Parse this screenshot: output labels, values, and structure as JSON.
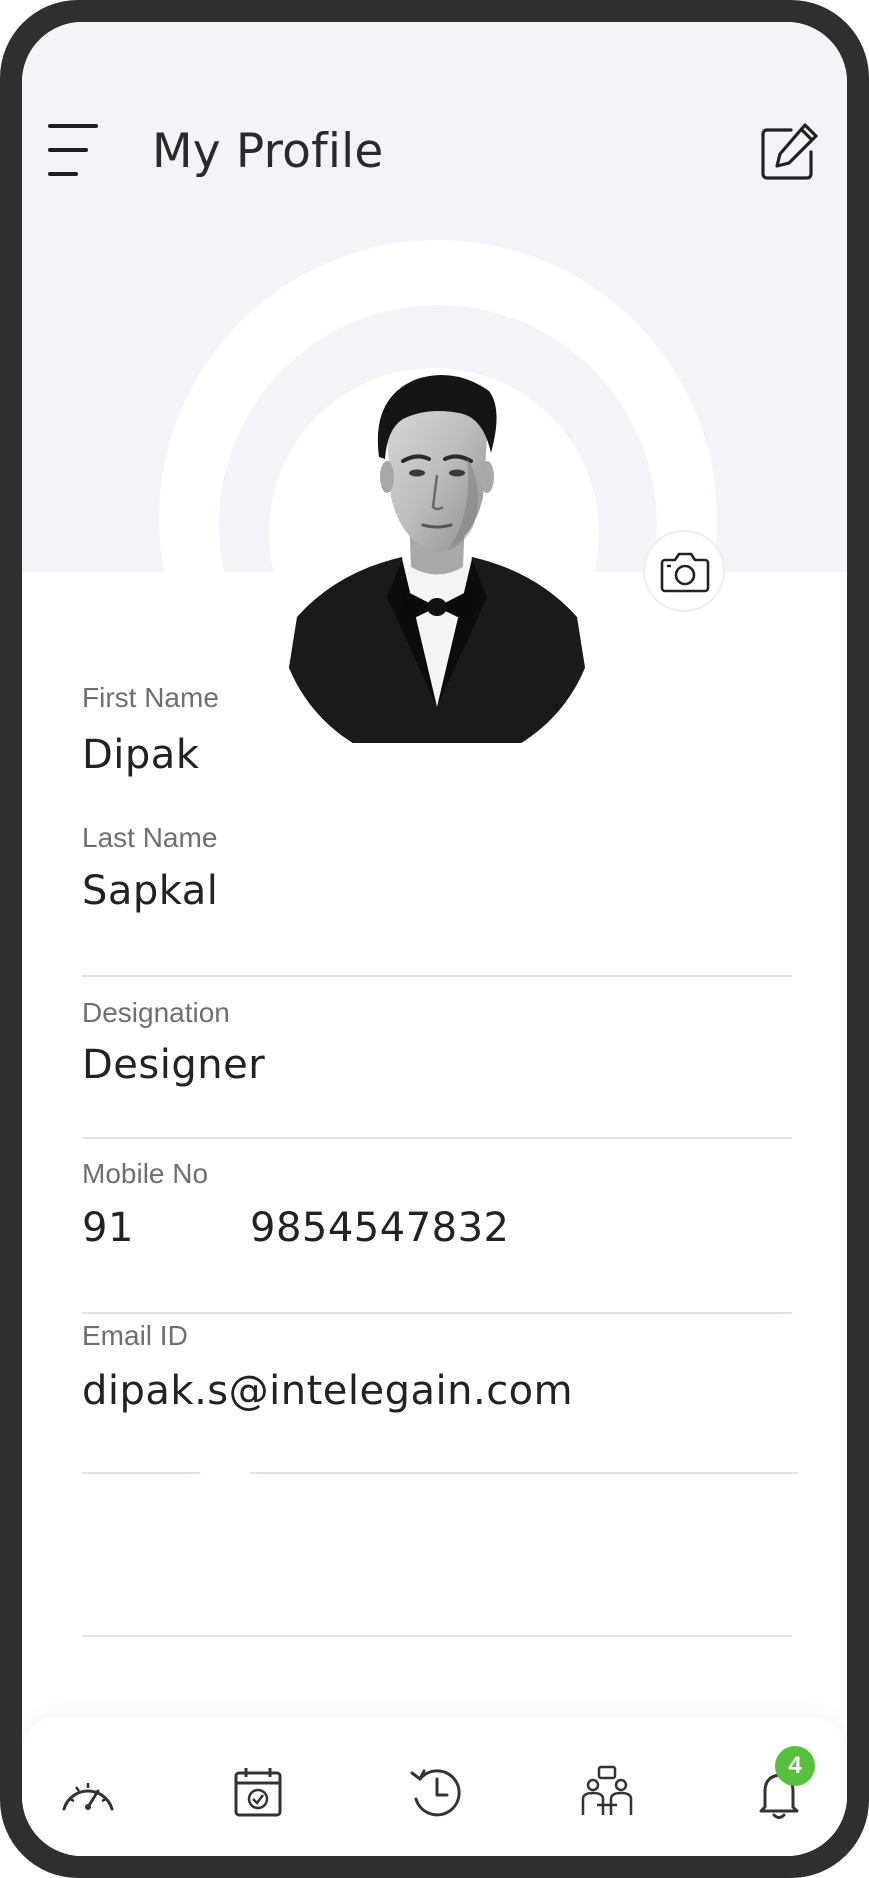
{
  "header": {
    "title": "My Profile",
    "menu_icon": "hamburger-menu-icon",
    "edit_icon": "edit-icon"
  },
  "profile": {
    "avatar_alt": "profile-photo",
    "camera_icon": "camera-icon"
  },
  "form": {
    "first_name": {
      "label": "First Name",
      "value": "Dipak"
    },
    "last_name": {
      "label": "Last Name",
      "value": "Sapkal"
    },
    "designation": {
      "label": "Designation",
      "value": "Designer"
    },
    "mobile": {
      "label": "Mobile No",
      "country_code": "91",
      "number": "9854547832"
    },
    "email": {
      "label": "Email ID",
      "value": "dipak.s@intelegain.com"
    }
  },
  "bottom_nav": {
    "items": [
      {
        "icon": "speedometer-icon"
      },
      {
        "icon": "calendar-check-icon"
      },
      {
        "icon": "history-clock-icon"
      },
      {
        "icon": "meeting-people-icon"
      },
      {
        "icon": "bell-icon"
      }
    ],
    "notification_count": "4"
  },
  "colors": {
    "header_background": "#f3f4fa",
    "badge": "#57c13e",
    "frame": "#2f2f2f"
  }
}
